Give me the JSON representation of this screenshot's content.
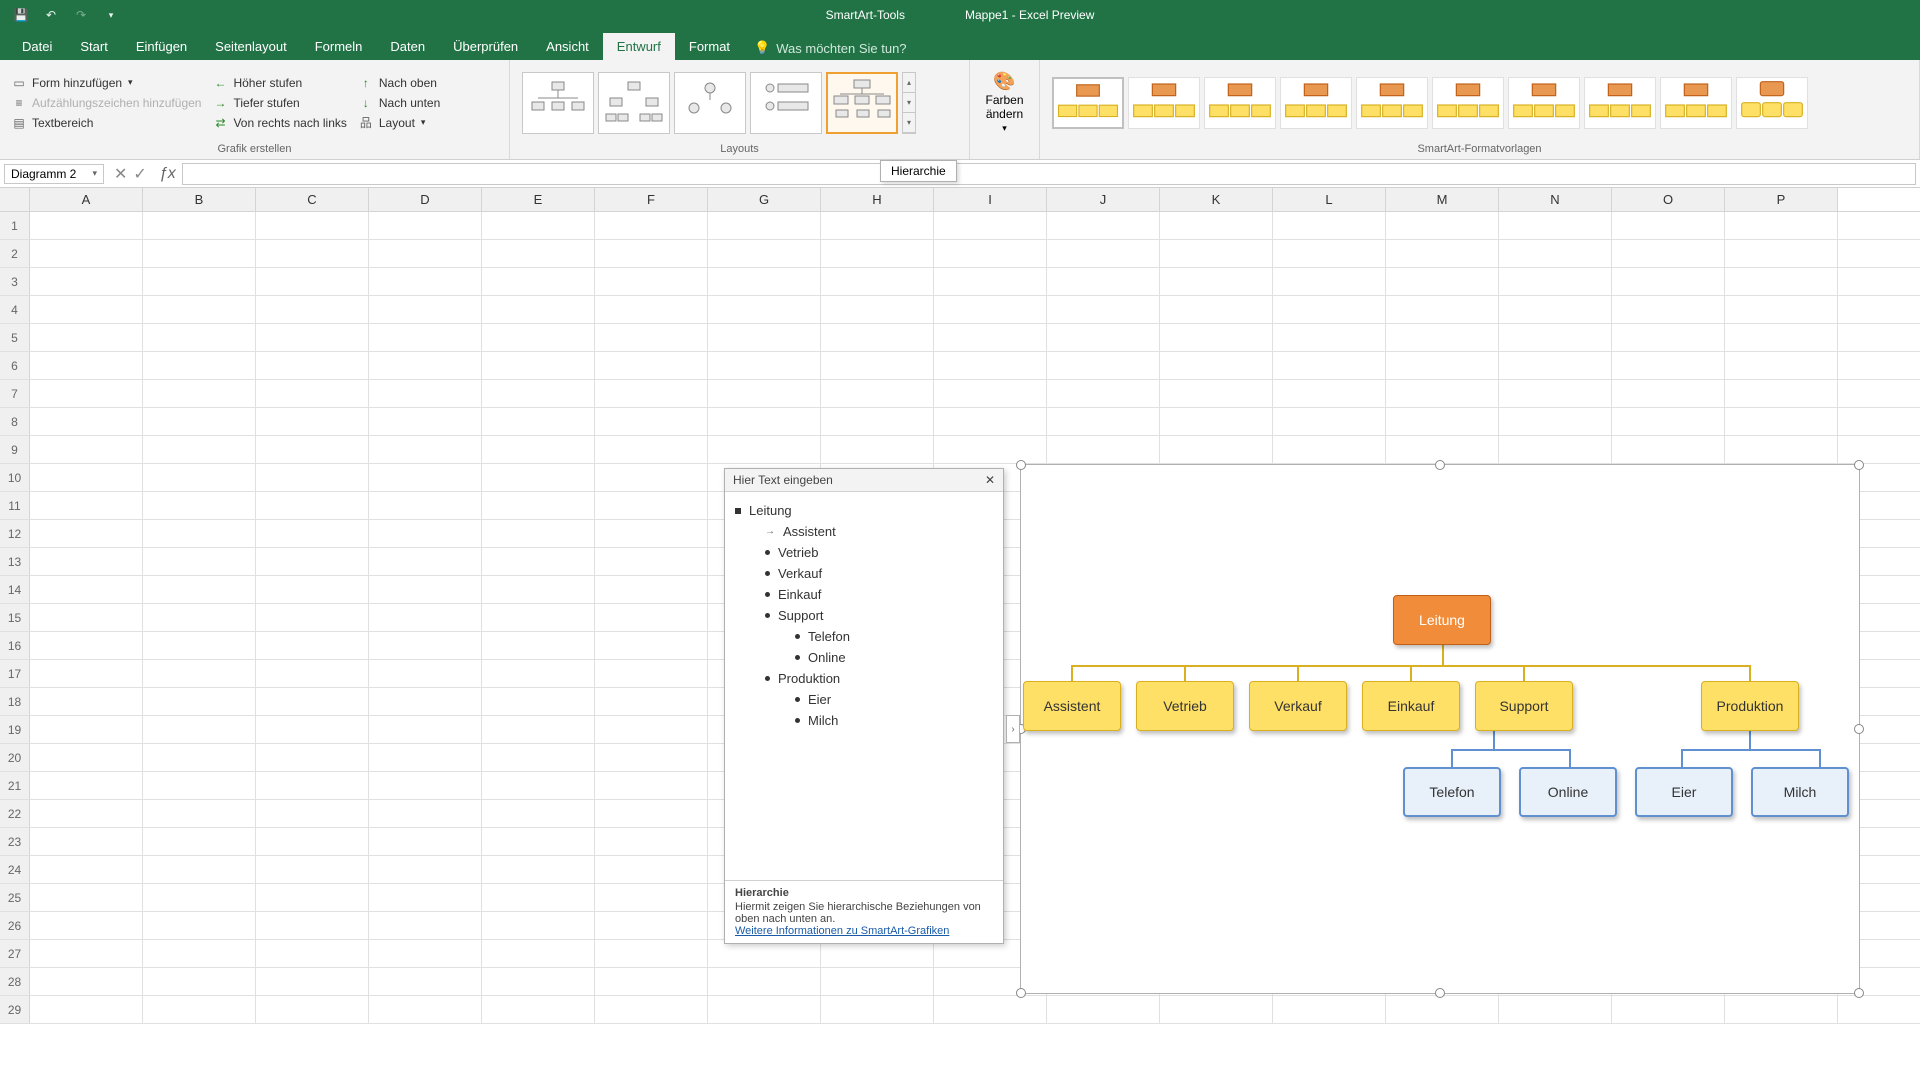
{
  "titlebar": {
    "tools_label": "SmartArt-Tools",
    "doc_title": "Mappe1  -  Excel Preview"
  },
  "tabs": {
    "datei": "Datei",
    "start": "Start",
    "einfuegen": "Einfügen",
    "seitenlayout": "Seitenlayout",
    "formeln": "Formeln",
    "daten": "Daten",
    "ueberpruefen": "Überprüfen",
    "ansicht": "Ansicht",
    "entwurf": "Entwurf",
    "format": "Format",
    "tellme": "Was möchten Sie tun?"
  },
  "ribbon": {
    "g1": {
      "form_hinzu": "Form hinzufügen",
      "aufz_hinzu": "Aufzählungszeichen hinzufügen",
      "textbereich": "Textbereich",
      "hoeher": "Höher stufen",
      "tiefer": "Tiefer stufen",
      "vrnl": "Von rechts nach links",
      "nach_oben": "Nach oben",
      "nach_unten": "Nach unten",
      "layout": "Layout",
      "label": "Grafik erstellen"
    },
    "g2_label": "Layouts",
    "g3": {
      "farben": "Farben ändern"
    },
    "g4_label": "SmartArt-Formatvorlagen"
  },
  "namebox": "Diagramm 2",
  "tooltip": "Hierarchie",
  "columns": [
    "A",
    "B",
    "C",
    "D",
    "E",
    "F",
    "G",
    "H",
    "I",
    "J",
    "K",
    "L",
    "M",
    "N",
    "O",
    "P"
  ],
  "textpane": {
    "title": "Hier Text eingeben",
    "items": [
      {
        "lvl": 0,
        "txt": "Leitung"
      },
      {
        "lvl": 1,
        "txt": "Assistent",
        "arrow": true
      },
      {
        "lvl": 1,
        "txt": "Vetrieb"
      },
      {
        "lvl": 1,
        "txt": "Verkauf"
      },
      {
        "lvl": 1,
        "txt": "Einkauf"
      },
      {
        "lvl": 1,
        "txt": "Support"
      },
      {
        "lvl": 2,
        "txt": "Telefon"
      },
      {
        "lvl": 2,
        "txt": "Online"
      },
      {
        "lvl": 1,
        "txt": "Produktion"
      },
      {
        "lvl": 2,
        "txt": "Eier"
      },
      {
        "lvl": 2,
        "txt": "Milch"
      }
    ],
    "footer_title": "Hierarchie",
    "footer_desc": "Hiermit zeigen Sie hierarchische Beziehungen von oben nach unten an.",
    "footer_link": "Weitere Informationen zu SmartArt-Grafiken"
  },
  "smartart": {
    "root": "Leitung",
    "l2": [
      "Assistent",
      "Vetrieb",
      "Verkauf",
      "Einkauf",
      "Support",
      "Produktion"
    ],
    "l3": [
      "Telefon",
      "Online",
      "Eier",
      "Milch"
    ]
  }
}
